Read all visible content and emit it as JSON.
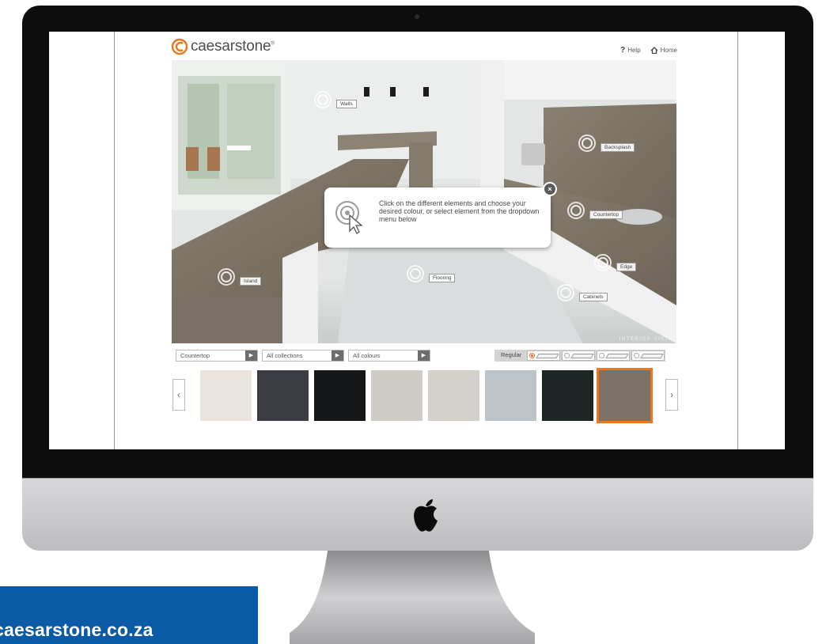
{
  "brand": {
    "name": "caesarstone",
    "trademark": "®",
    "accent_color": "#e8771e"
  },
  "topnav": {
    "help_icon": "?",
    "help_label": "Help",
    "home_label": "Home"
  },
  "hotspots": [
    {
      "id": "walls",
      "label": "Walls"
    },
    {
      "id": "backsplash",
      "label": "Backsplash"
    },
    {
      "id": "countertop",
      "label": "Countertop"
    },
    {
      "id": "edge",
      "label": "Edge"
    },
    {
      "id": "island",
      "label": "Island"
    },
    {
      "id": "flooring",
      "label": "Flooring"
    },
    {
      "id": "cabinets",
      "label": "Cabinets"
    }
  ],
  "callout": {
    "text": "Click on the different elements and choose your desired colour, or select element from the dropdown menu below",
    "close_glyph": "×"
  },
  "watermark": "INTERIOR VISTA",
  "filters": {
    "element": "Countertop",
    "collection": "All collections",
    "colour": "All colours",
    "arrow_glyph": "▶"
  },
  "edge_profiles": {
    "label": "Regular",
    "options": [
      {
        "selected": true
      },
      {
        "selected": false
      },
      {
        "selected": false
      },
      {
        "selected": false
      }
    ]
  },
  "carousel": {
    "prev_glyph": "‹",
    "next_glyph": "›",
    "swatches": [
      {
        "name": "white-marble-swatch",
        "color": "#e9e4de",
        "selected": false
      },
      {
        "name": "dark-grey-granite-swatch",
        "color": "#3b3d42",
        "selected": false
      },
      {
        "name": "black-marble-swatch",
        "color": "#151618",
        "selected": false
      },
      {
        "name": "light-grey-concrete-swatch",
        "color": "#cfccc8",
        "selected": false
      },
      {
        "name": "pale-grey-swatch",
        "color": "#d3d0cc",
        "selected": false
      },
      {
        "name": "embossed-pattern-swatch",
        "color": "#bcc4ca",
        "selected": false
      },
      {
        "name": "dark-green-leather-swatch",
        "color": "#1d2624",
        "selected": false
      },
      {
        "name": "taupe-concrete-swatch",
        "color": "#7c7266",
        "selected": true
      }
    ]
  },
  "banner": {
    "text": "caesarstone.co.za",
    "color": "#0a5aa5"
  }
}
